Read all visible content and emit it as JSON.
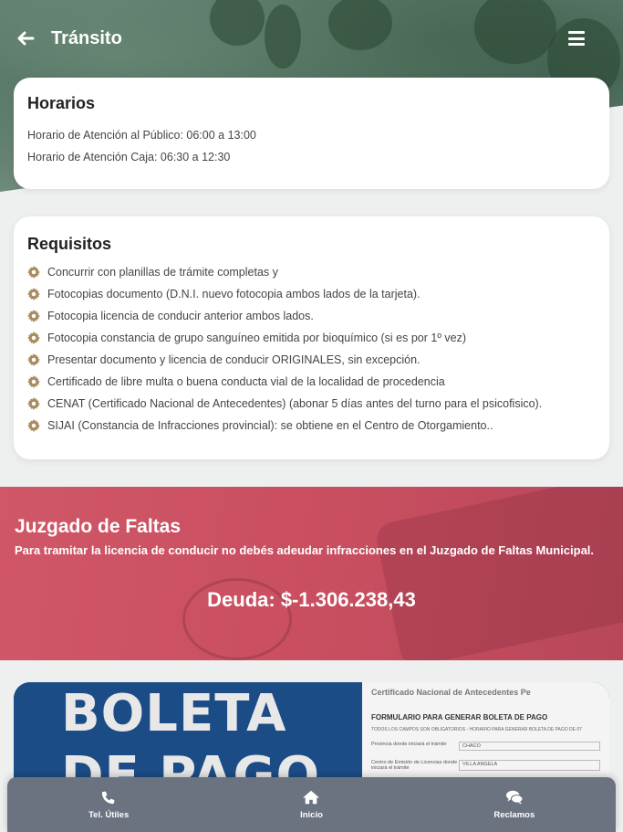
{
  "header": {
    "title": "Tránsito",
    "back_icon": "arrow-left-icon",
    "menu_icon": "hamburger-menu-icon"
  },
  "horarios": {
    "title": "Horarios",
    "lines": [
      "Horario de Atención al Público: 06:00 a 13:00",
      "Horario de Atención Caja: 06:30 a 12:30"
    ]
  },
  "requisitos": {
    "title": "Requisitos",
    "icon": "gear-icon",
    "items": [
      "Concurrir con planillas de trámite completas y",
      "Fotocopias documento (D.N.I. nuevo fotocopia ambos lados de la tarjeta).",
      "Fotocopia licencia de conducir anterior ambos lados.",
      "Fotocopia constancia de grupo sanguíneo emitida por bioquímico (si es por 1º vez)",
      "Presentar documento y licencia de conducir ORIGINALES, sin excepción.",
      "Certificado de libre multa o buena conducta vial de la localidad de procedencia",
      "CENAT (Certificado Nacional de Antecedentes) (abonar 5 días antes del turno para el psicofisico).",
      "SIJAI (Constancia de Infracciones provincial): se obtiene en el Centro de Otorgamiento.."
    ]
  },
  "juzgado": {
    "title": "Juzgado de Faltas",
    "text": "Para tramitar la licencia de conducir no debés adeudar infracciones en el Juzgado de Faltas Municipal.",
    "deuda": "Deuda: $-1.306.238,43"
  },
  "boleta": {
    "line1": "BOLETA",
    "line2": "DE PAGO",
    "form_header": "Certificado Nacional de Antecedentes Pe",
    "form_title": "FORMULARIO PARA GENERAR BOLETA DE PAGO",
    "form_sub": "TODOS LOS CAMPOS SON OBLIGATORIOS - HORARIO PARA GENERAR BOLETA DE PAGO DE 07",
    "rows": [
      {
        "k": "Provincia donde iniciará el trámite",
        "v": "CHACO"
      },
      {
        "k": "Centro de Emisión de Licencias donde iniciará el trámite",
        "v": "VILLA ANGELA"
      }
    ]
  },
  "bottom_nav": [
    {
      "label": "Tel. Útiles",
      "icon": "phone-icon"
    },
    {
      "label": "Inicio",
      "icon": "home-icon"
    },
    {
      "label": "Reclamos",
      "icon": "comments-icon"
    }
  ],
  "colors": {
    "accent_red": "#c94f60",
    "nav_gray": "#6b7280",
    "gear": "#a88a5c"
  }
}
